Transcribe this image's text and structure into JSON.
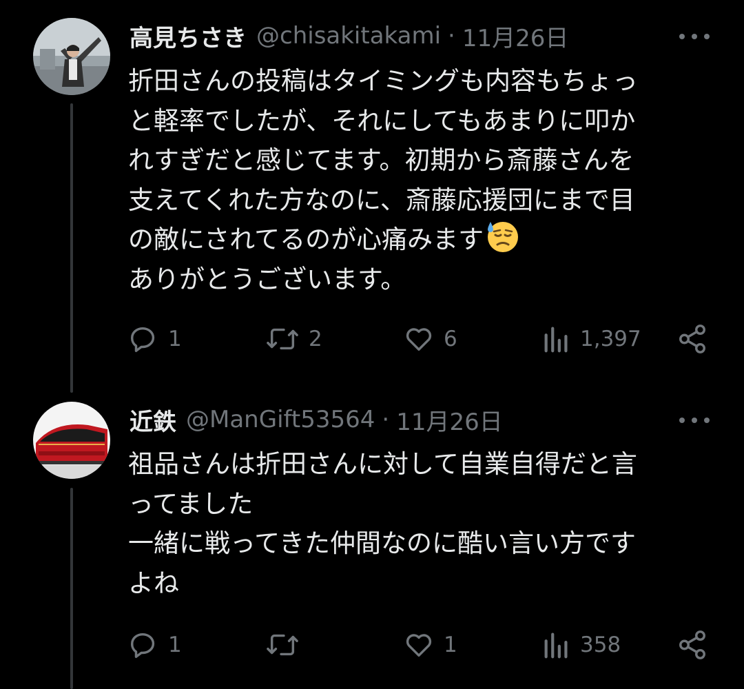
{
  "tweets": [
    {
      "name": "高見ちさき",
      "handle": "@chisakitakami",
      "separator": "·",
      "date": "11月26日",
      "text": "折田さんの投稿はタイミングも内容もちょっ\nと軽率でしたが、それにしてもあまりに叩か\nれすぎだと感じてます。初期から斎藤さんを\n支えてくれた方なのに、斎藤応援団にまで目\nの敵にされてるのが心痛みます",
      "text_after_emoji": "\nありがとうございます。",
      "emoji": "downcast-face-with-sweat",
      "replies": "1",
      "retweets": "2",
      "likes": "6",
      "views": "1,397"
    },
    {
      "name": "近鉄",
      "handle": "@ManGift53564",
      "separator": "·",
      "date": "11月26日",
      "text": "祖品さんは折田さんに対して自業自得だと言\nってました\n一緒に戦ってきた仲間なのに酷い言い方です\nよね",
      "replies": "1",
      "retweets": "",
      "likes": "1",
      "views": "358"
    }
  ],
  "icons": [
    "reply-icon",
    "retweet-icon",
    "like-icon",
    "views-icon",
    "share-icon",
    "more-icon"
  ],
  "colors": {
    "background": "#000000",
    "text": "#e7e9ea",
    "secondary": "#71767b",
    "thread_line": "#333639"
  }
}
